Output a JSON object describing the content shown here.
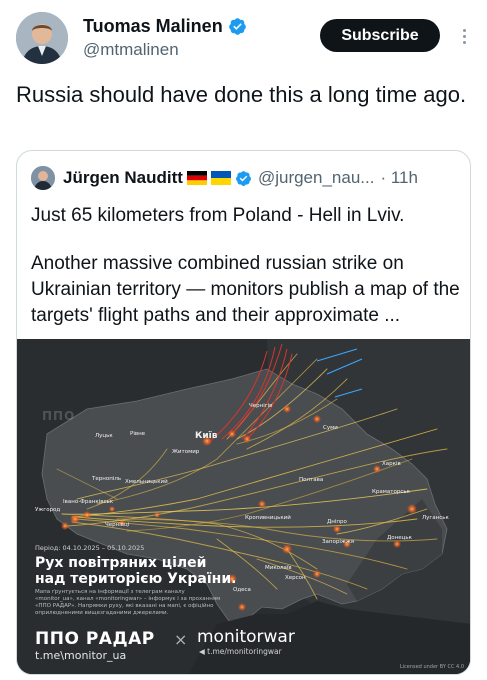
{
  "post": {
    "author": {
      "name": "Tuomas Malinen",
      "handle": "@mtmalinen",
      "verified": true
    },
    "subscribe_label": "Subscribe",
    "text": "Russia should have done this a long time ago."
  },
  "quote": {
    "author": {
      "name": "Jürgen Nauditt",
      "flags": [
        "germany-flag",
        "ukraine-flag"
      ],
      "handle": "@jurgen_nau...",
      "verified": true
    },
    "time": "· 11h",
    "line1": "Just 65 kilometers from Poland - Hell in Lviv.",
    "body": "Another massive combined russian strike on Ukrainian territory — monitors publish a map of the targets' flight paths and their approximate ..."
  },
  "map": {
    "watermark": "ППО",
    "period": "Період: 04.10.2025 – 05.10.2025",
    "title_line1": "Рух повітряних цілей",
    "title_line2": "над територією України.",
    "note": "Мапа ґрунтується на інформації з телеграм каналу «monitor_ua», канал «monitoringwar» – інформує і за проханням «ППО РАДАР». Напрямки руху, які вказані на мапі, є офіційно оприлюдненими вищезгаданими джерелами.",
    "brand_left": "ППО РАДАР",
    "brand_left_link": "t.me\\monitor_ua",
    "brand_cross": "×",
    "brand_right": "monitorwar",
    "brand_right_link": "t.me/monitoringwar",
    "license": "Licensed under BY CC 4.0",
    "cities": {
      "kyiv": "Київ",
      "lutsk": "Луцьк",
      "rivne": "Рівне",
      "zhytomyr": "Житомир",
      "chernihiv": "Чернігів",
      "sumy": "Суми",
      "kharkiv": "Харків",
      "poltava": "Полтава",
      "ternopil": "Тернопіль",
      "khmelnytskyi": "Хмельницький",
      "ivano_frankivsk": "Івано-Франківськ",
      "uzhhorod": "Ужгород",
      "chernivtsi": "Чернівці",
      "kropyvnytskyi": "Кропивницький",
      "dnipro": "Дніпро",
      "donetsk": "Донецьк",
      "luhansk": "Луганськ",
      "zaporizhzhia": "Запоріжжя",
      "mykolaiv": "Миколаїв",
      "kherson": "Херсон",
      "odesa": "Одеса",
      "kramatorsk": "Краматорськ"
    }
  },
  "colors": {
    "accent_blue": "#1d9bf0",
    "text_primary": "#0f1419",
    "text_secondary": "#536471",
    "border": "#cfd9de",
    "map_bg": "#2a2d30",
    "path_yellow": "#e8c24a",
    "path_red": "#d8342c",
    "path_blue": "#3aa7ff"
  }
}
